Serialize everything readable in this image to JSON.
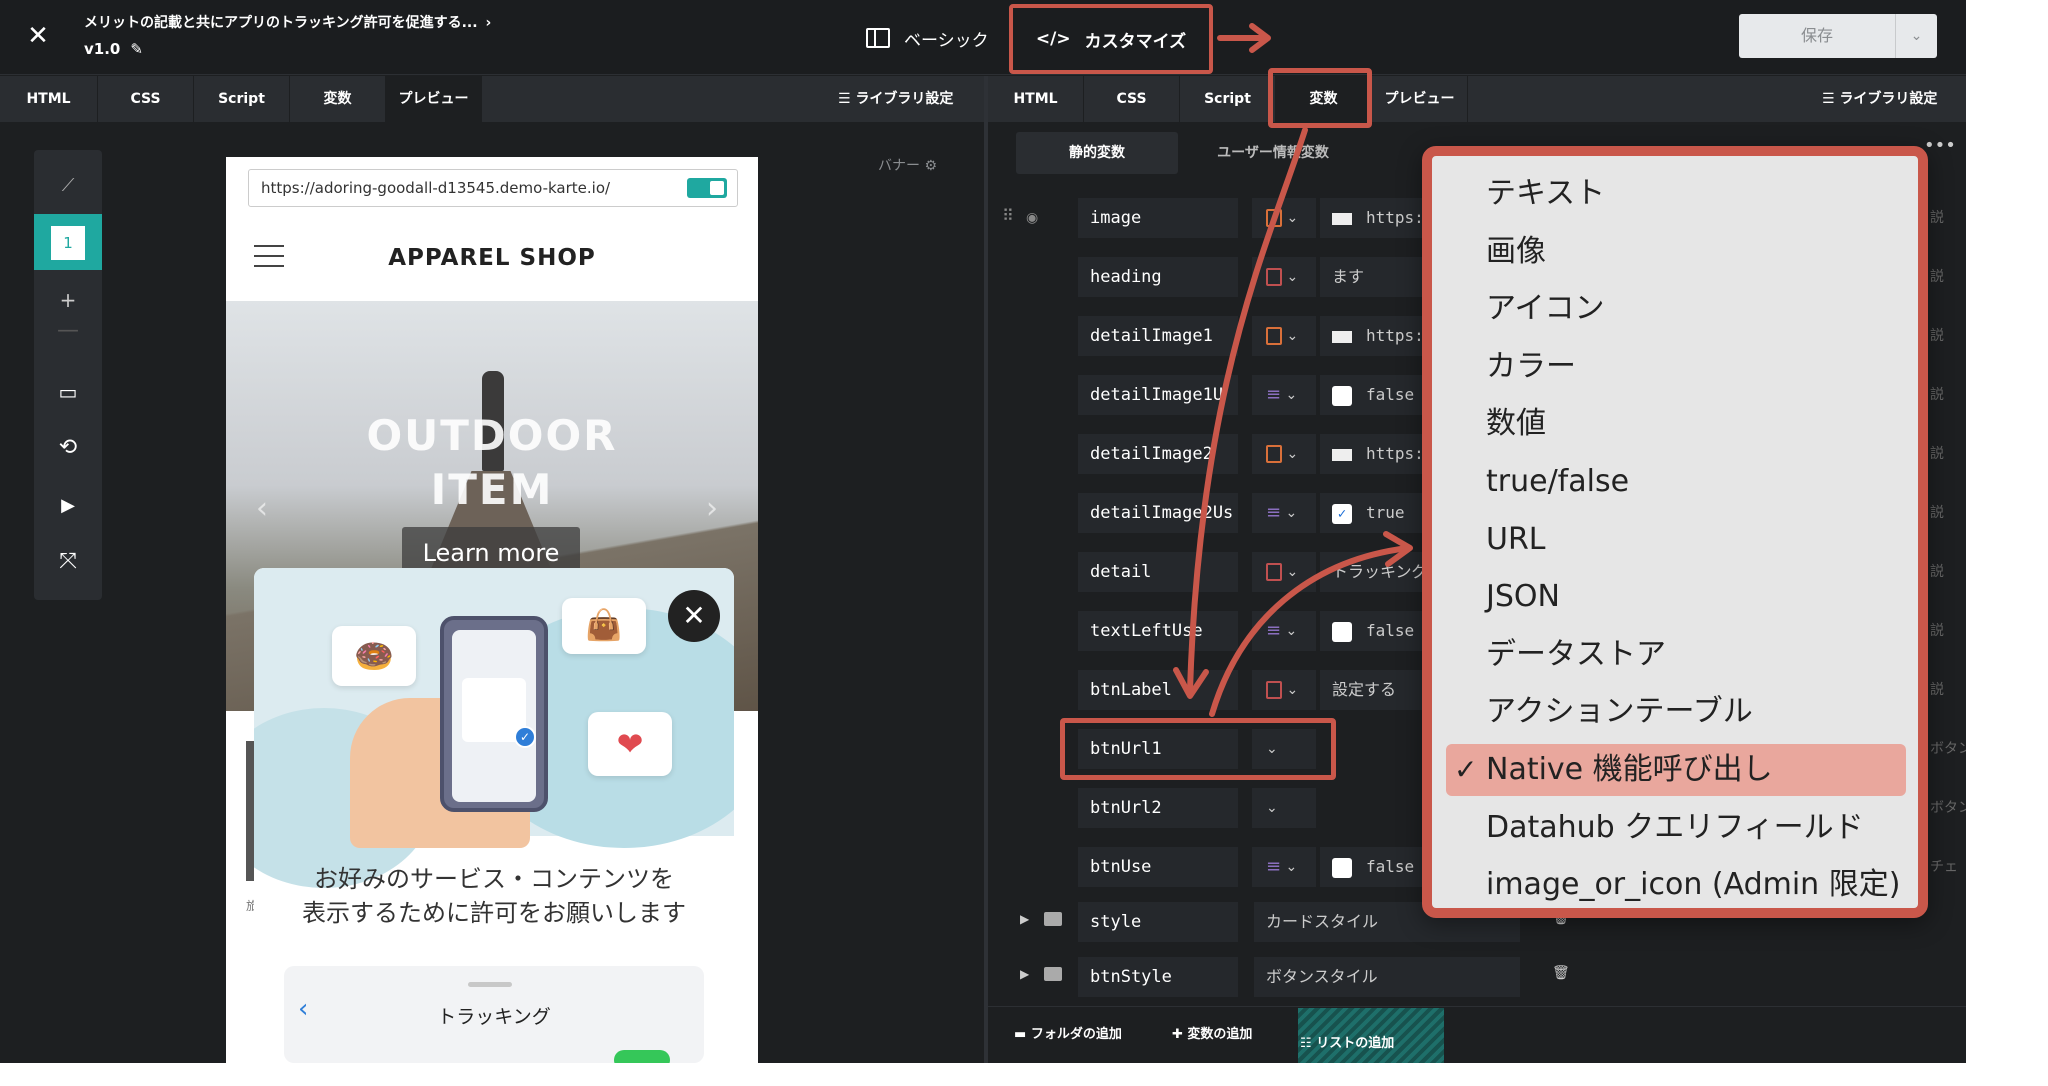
{
  "header": {
    "title": "メリットの記載と共にアプリのトラッキング許可を促進する...",
    "version": "v1.0",
    "mode_basic": "ベーシック",
    "mode_custom": "カスタマイズ",
    "save": "保存"
  },
  "tabs_left": [
    "HTML",
    "CSS",
    "Script",
    "変数",
    "プレビュー"
  ],
  "tabs_right": [
    "HTML",
    "CSS",
    "Script",
    "変数",
    "プレビュー"
  ],
  "library_settings": "ライブラリ設定",
  "toolbar": {
    "page_number": "1"
  },
  "preview": {
    "banner_label": "バナー",
    "url": "https://adoring-goodall-d13545.demo-karte.io/",
    "shop_name": "APPAREL SHOP",
    "hero_title_1": "OUTDOOR",
    "hero_title_2": "ITEM",
    "hero_button": "Learn more",
    "lower_text": "旅",
    "modal_message_1": "お好みのサービス・コンテンツを",
    "modal_message_2": "表示するために許可をお願いします",
    "tracking_title": "トラッキング"
  },
  "variables": {
    "tab_static": "静的変数",
    "tab_user": "ユーザー情報変数",
    "rows": [
      {
        "name": "image",
        "type": "img",
        "value": "https:",
        "desc": "説"
      },
      {
        "name": "heading",
        "type": "txt",
        "value": "ます",
        "desc": "説"
      },
      {
        "name": "detailImage1",
        "type": "img",
        "value": "https:",
        "desc": "説"
      },
      {
        "name": "detailImage1U",
        "type": "bool",
        "value": "false",
        "desc": "説"
      },
      {
        "name": "detailImage2",
        "type": "img",
        "value": "https:",
        "desc": "説"
      },
      {
        "name": "detailImage2Us",
        "type": "bool",
        "value": "true",
        "desc": "説"
      },
      {
        "name": "detail",
        "type": "txt",
        "value": "トラッキング",
        "desc": "説"
      },
      {
        "name": "textLeftUse",
        "type": "bool",
        "value": "false",
        "desc": "説"
      },
      {
        "name": "btnLabel",
        "type": "txt",
        "value": "設定する",
        "desc": "説"
      },
      {
        "name": "btnUrl1",
        "type": "none",
        "value": "",
        "desc": "ボタン"
      },
      {
        "name": "btnUrl2",
        "type": "none",
        "value": "",
        "desc": "ボタン"
      },
      {
        "name": "btnUse",
        "type": "bool",
        "value": "false",
        "desc": "チェ"
      }
    ],
    "folders": [
      {
        "name": "style",
        "value": "カードスタイル"
      },
      {
        "name": "btnStyle",
        "value": "ボタンスタイル"
      }
    ],
    "add_folder": "フォルダの追加",
    "add_variable": "変数の追加",
    "add_list": "リストの追加"
  },
  "type_dropdown": {
    "options": [
      "テキスト",
      "画像",
      "アイコン",
      "カラー",
      "数値",
      "true/false",
      "URL",
      "JSON",
      "データストア",
      "アクションテーブル",
      "Native 機能呼び出し",
      "Datahub クエリフィールド",
      "image_or_icon (Admin 限定)"
    ],
    "selected_index": 10
  },
  "colors": {
    "highlight": "#c9574a",
    "accent": "#1fa8a0"
  }
}
